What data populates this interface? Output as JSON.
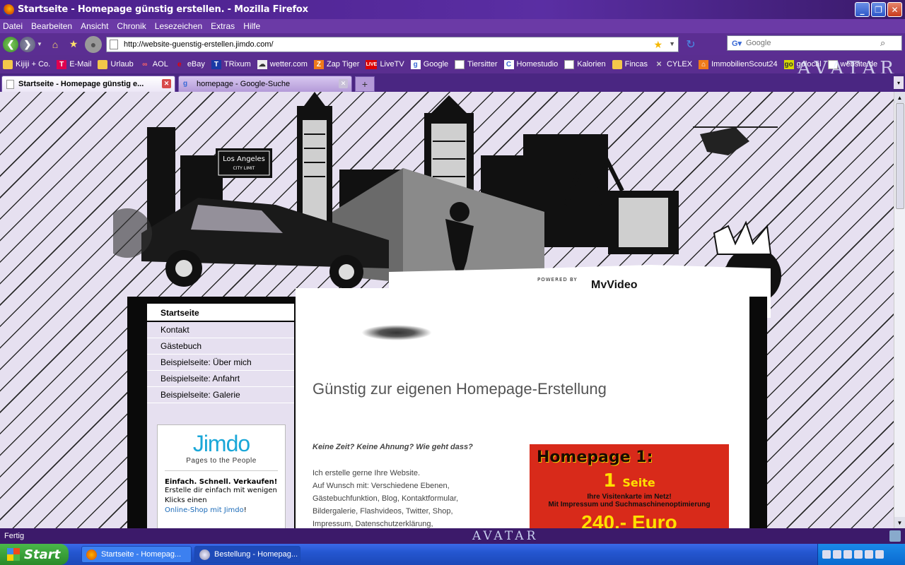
{
  "window": {
    "title": "Startseite - Homepage günstig erstellen. - Mozilla Firefox"
  },
  "menu": [
    "Datei",
    "Bearbeiten",
    "Ansicht",
    "Chronik",
    "Lesezeichen",
    "Extras",
    "Hilfe"
  ],
  "nav": {
    "url": "http://website-guenstig-erstellen.jimdo.com/",
    "search_placeholder": "Google"
  },
  "bookmarks": [
    {
      "label": "Kijiji + Co.",
      "icon": "folder-icon"
    },
    {
      "label": "E-Mail",
      "icon": "telekom-icon"
    },
    {
      "label": "Urlaub",
      "icon": "folder-icon"
    },
    {
      "label": "AOL",
      "icon": "aol-icon"
    },
    {
      "label": "eBay",
      "icon": "ebay-icon"
    },
    {
      "label": "TRixum",
      "icon": "trixum-icon"
    },
    {
      "label": "wetter.com",
      "icon": "weather-icon"
    },
    {
      "label": "Zap Tiger",
      "icon": "tiger-icon"
    },
    {
      "label": "LiveTV",
      "icon": "live-icon"
    },
    {
      "label": "Google",
      "icon": "google-icon"
    },
    {
      "label": "Tiersitter",
      "icon": "page-icon"
    },
    {
      "label": "Homestudio",
      "icon": "homestudio-icon"
    },
    {
      "label": "Kalorien",
      "icon": "page-icon"
    },
    {
      "label": "Fincas",
      "icon": "folder-icon"
    },
    {
      "label": "CYLEX",
      "icon": "cylex-icon"
    },
    {
      "label": "ImmobilienScout24",
      "icon": "immo-icon"
    },
    {
      "label": "golocal",
      "icon": "golocal-icon"
    },
    {
      "label": "website.de",
      "icon": "page-icon"
    }
  ],
  "brand_banner": "AVATAR",
  "tabs": [
    {
      "label": "Startseite - Homepage günstig e...",
      "active": true
    },
    {
      "label": "homepage - Google-Suche",
      "active": false
    }
  ],
  "site": {
    "header_sign_line1": "Los Angeles",
    "header_sign_line2": "CITY LIMIT",
    "powered_by": "POWERED BY",
    "myvideo": "MyVideo",
    "sidebar": [
      {
        "label": "Startseite",
        "active": true
      },
      {
        "label": "Kontakt"
      },
      {
        "label": "Gästebuch"
      },
      {
        "label": "Beispielseite: Über mich"
      },
      {
        "label": "Beispielseite: Anfahrt"
      },
      {
        "label": "Beispielseite: Galerie"
      }
    ],
    "jimdo": {
      "logo": "Jimdo",
      "tagline": "Pages to the People",
      "headline": "Einfach. Schnell. Verkaufen!",
      "text": "Erstelle dir einfach mit wenigen Klicks einen",
      "link": "Online-Shop mit Jimdo",
      "link_suffix": "!"
    },
    "heading": "Günstig zur eigenen Homepage-Erstellung",
    "lead": "Keine Zeit? Keine Ahnung? Wie geht dass?",
    "body_lines": [
      "Ich erstelle gerne Ihre Website.",
      "Auf Wunsch mit: Verschiedene Ebenen,",
      "Gästebuchfunktion, Blog, Kontaktformular,",
      "Bildergalerie, Flashvideos, Twitter, Shop,",
      "Impressum, Datenschutzerklärung,"
    ],
    "promo": {
      "title": "Homepage 1:",
      "pages_num": "1",
      "pages_word": "Seite",
      "line1": "Ihre Visitenkarte im Netz!",
      "line2": "Mit Impressum und Suchmaschinenoptimierung",
      "price": "240,- Euro"
    }
  },
  "status": {
    "text": "Fertig",
    "banner": "AVATAR"
  },
  "taskbar": {
    "start": "Start",
    "tasks": [
      {
        "label": "Startseite - Homepag..."
      },
      {
        "label": "Bestellung - Homepag..."
      }
    ]
  },
  "colors": {
    "chrome_purple": "#5b2e92",
    "page_bg": "#e6e0f0",
    "promo_red": "#d82a1a",
    "promo_yellow": "#ffe000",
    "jimdo_blue": "#1aa7d8"
  }
}
